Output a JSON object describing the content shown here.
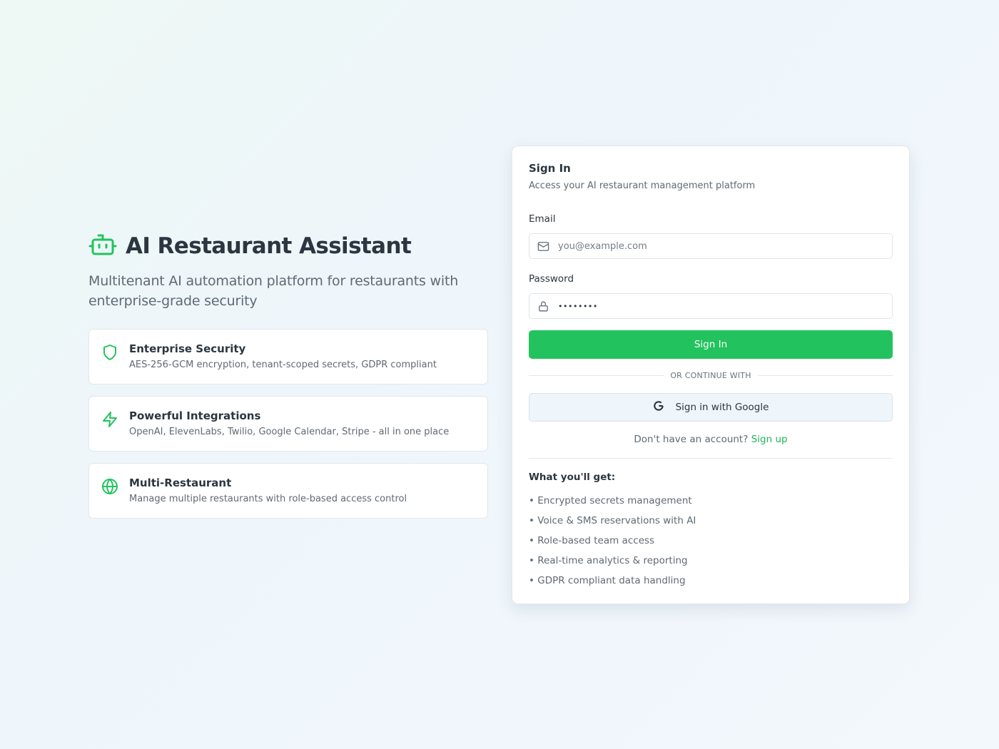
{
  "brand": {
    "title": "AI Restaurant Assistant",
    "subtitle": "Multitenant AI automation platform for restaurants with enterprise-grade security",
    "icon": "robot-icon",
    "accent_color": "#22c35e"
  },
  "features": [
    {
      "icon": "shield-icon",
      "title": "Enterprise Security",
      "description": "AES-256-GCM encryption, tenant-scoped secrets, GDPR compliant"
    },
    {
      "icon": "lightning-icon",
      "title": "Powerful Integrations",
      "description": "OpenAI, ElevenLabs, Twilio, Google Calendar, Stripe - all in one place"
    },
    {
      "icon": "globe-icon",
      "title": "Multi-Restaurant",
      "description": "Manage multiple restaurants with role-based access control"
    }
  ],
  "signin": {
    "title": "Sign In",
    "subtitle": "Access your AI restaurant management platform",
    "email_label": "Email",
    "email_placeholder": "you@example.com",
    "email_value": "",
    "password_label": "Password",
    "password_value": "••••••••",
    "submit_label": "Sign In",
    "divider_text": "OR CONTINUE WITH",
    "google_label": "Sign in with Google",
    "no_account_text": "Don't have an account?",
    "signup_link": "Sign up",
    "benefits_title": "What you'll get:",
    "benefits": [
      "• Encrypted secrets management",
      "• Voice & SMS reservations with AI",
      "• Role-based team access",
      "• Real-time analytics & reporting",
      "• GDPR compliant data handling"
    ]
  }
}
